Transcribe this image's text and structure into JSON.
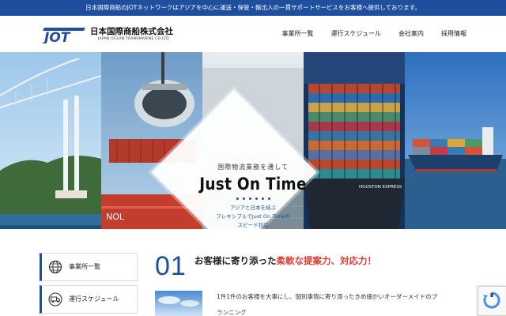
{
  "topbar": {
    "text": "日本国際商船のJOTネットワークはアジアを中心に運送・保管・輸出入の一貫サポートサービスをお客様へ提供しております。"
  },
  "logo": {
    "mark": "JOT",
    "name_jp": "日本国際商船株式会社",
    "name_en": "JAPAN OCEAN TRANSMARINE CO.LTD"
  },
  "nav": {
    "items": [
      "事業所一覧",
      "運行スケジュール",
      "会社案内",
      "採用情報"
    ]
  },
  "hero": {
    "subtitle": "国際物流業務を通して",
    "title": "Just On Time",
    "desc_line1": "アジアと日本を結ぶ",
    "desc_line2": "フレキシブルでJust On Timeの",
    "desc_line3": "スピード対応",
    "ship_name": "HOUSTON EXPRESS",
    "container_text": "NOL"
  },
  "sidebar": {
    "items": [
      {
        "label": "事業所一覧",
        "icon": "globe-icon"
      },
      {
        "label": "運行スケジュール",
        "icon": "truck-icon"
      }
    ]
  },
  "section": {
    "number": "01",
    "heading_plain": "お客様に寄り添った",
    "heading_highlight": "柔軟な提案力、対応力！",
    "body_line1": "1件1件のお客様を大事にし、個別事情に寄り添ったきめ細かいオーダーメイドのプ",
    "body_line2": "ランニング"
  },
  "colors": {
    "brand_blue": "#1e4f9e",
    "accent_red": "#e23a2e"
  }
}
